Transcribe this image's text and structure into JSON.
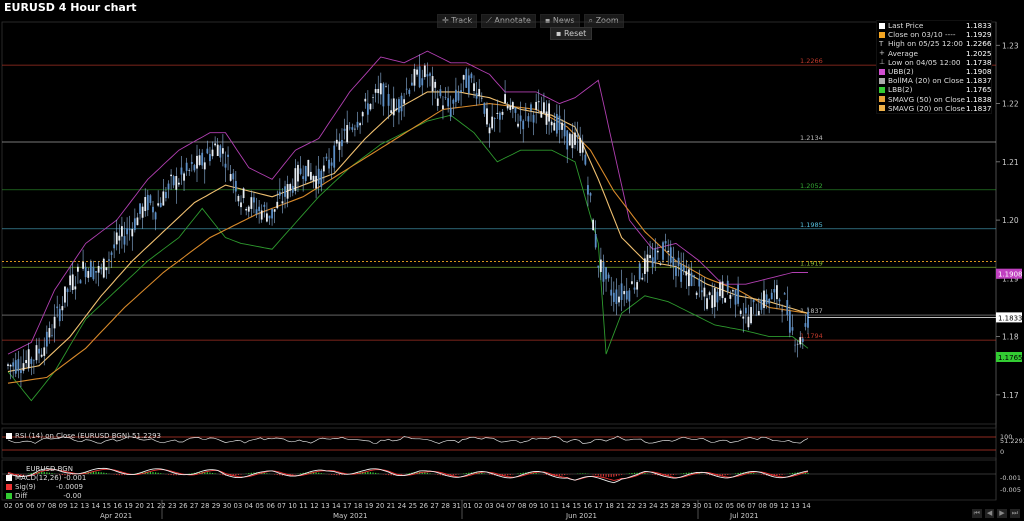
{
  "title": "EURUSD 4 Hour chart",
  "toolbar": {
    "track": "Track",
    "annotate": "Annotate",
    "news": "News",
    "zoom": "Zoom",
    "reset": "Reset"
  },
  "legend": [
    {
      "label": "Last Price",
      "value": "1.1833",
      "color": "#ffffff"
    },
    {
      "label": "Close on 03/10 ----",
      "value": "1.1929",
      "color": "#f5a623"
    },
    {
      "label": "High on 05/25 12:00",
      "value": "1.2266",
      "color": "#000000",
      "symbol": "T"
    },
    {
      "label": "Average",
      "value": "1.2025",
      "color": "#000000",
      "symbol": "+"
    },
    {
      "label": "Low on 04/05 12:00",
      "value": "1.1738",
      "color": "#000000",
      "symbol": "⊥"
    },
    {
      "label": "UBB(2)",
      "value": "1.1908",
      "color": "#d24fd2"
    },
    {
      "label": "BollMA (20) on Close",
      "value": "1.1837",
      "color": "#aaaaaa"
    },
    {
      "label": "LBB(2)",
      "value": "1.1765",
      "color": "#33cc33"
    },
    {
      "label": "SMAVG (50) on Close",
      "value": "1.1838",
      "color": "#e8a33a"
    },
    {
      "label": "SMAVG (20) on Close",
      "value": "1.1837",
      "color": "#f0b24a"
    }
  ],
  "rsi_legend": "RSI (14) on Close (EURUSD BGN) 51.2293",
  "macd_legend": {
    "title": "EURUSD BGN",
    "macd": "MACD(12,26)",
    "macd_val": "-0.001",
    "sig": "Sig(9)",
    "sig_val": "-0.0009",
    "diff": "Diff",
    "diff_val": "-0.00"
  },
  "right_labels": {
    "ubb": "1.1908",
    "last": "1.1833",
    "lbb": "1.1765",
    "rsi": "51.2293",
    "rsi_100": "100",
    "rsi_0": "0",
    "macd": "-0.001",
    "macd_low": "-0.005"
  },
  "months": [
    "Apr 2021",
    "May 2021",
    "Jun 2021",
    "Jul 2021"
  ],
  "days": [
    "02",
    "05",
    "06",
    "07",
    "08",
    "09",
    "12",
    "13",
    "14",
    "15",
    "16",
    "19",
    "20",
    "21",
    "22",
    "23",
    "26",
    "27",
    "28",
    "29",
    "30",
    "03",
    "04",
    "05",
    "06",
    "07",
    "10",
    "11",
    "12",
    "13",
    "14",
    "17",
    "18",
    "19",
    "20",
    "21",
    "24",
    "25",
    "26",
    "27",
    "28",
    "31",
    "01",
    "02",
    "03",
    "04",
    "07",
    "08",
    "09",
    "10",
    "11",
    "14",
    "15",
    "16",
    "17",
    "18",
    "21",
    "22",
    "23",
    "24",
    "25",
    "28",
    "29",
    "30",
    "01",
    "02",
    "05",
    "06",
    "07",
    "08",
    "09",
    "12",
    "13",
    "14"
  ],
  "chart_data": {
    "type": "candlestick",
    "ylim": [
      1.165,
      1.234
    ],
    "yticks": [
      1.17,
      1.18,
      1.19,
      1.2,
      1.21,
      1.22,
      1.23
    ],
    "hlines": [
      {
        "value": 1.2266,
        "label": "1.2266",
        "color": "#c0392b"
      },
      {
        "value": 1.2134,
        "label": "1.2134",
        "color": "#bbbbbb"
      },
      {
        "value": 1.2052,
        "label": "1.2052",
        "color": "#33aa33"
      },
      {
        "value": 1.1985,
        "label": "1.1985",
        "color": "#56c1e0"
      },
      {
        "value": 1.1919,
        "label": "1.1919",
        "color": "#88bb33"
      },
      {
        "value": 1.1837,
        "label": "1.1837",
        "color": "#bbbbbb"
      },
      {
        "value": 1.1794,
        "label": "1.1794",
        "color": "#c0392b"
      }
    ],
    "reference_close": 1.1929,
    "price_path": [
      [
        0,
        1.175
      ],
      [
        3,
        1.176
      ],
      [
        5,
        1.179
      ],
      [
        8,
        1.189
      ],
      [
        10,
        1.192
      ],
      [
        12,
        1.191
      ],
      [
        14,
        1.196
      ],
      [
        16,
        1.199
      ],
      [
        18,
        1.203
      ],
      [
        19,
        1.202
      ],
      [
        21,
        1.206
      ],
      [
        23,
        1.208
      ],
      [
        25,
        1.21
      ],
      [
        27,
        1.213
      ],
      [
        28,
        1.211
      ],
      [
        30,
        1.204
      ],
      [
        32,
        1.202
      ],
      [
        34,
        1.201
      ],
      [
        36,
        1.205
      ],
      [
        38,
        1.209
      ],
      [
        40,
        1.207
      ],
      [
        42,
        1.211
      ],
      [
        44,
        1.216
      ],
      [
        46,
        1.219
      ],
      [
        48,
        1.222
      ],
      [
        50,
        1.219
      ],
      [
        52,
        1.224
      ],
      [
        54,
        1.225
      ],
      [
        55,
        1.222
      ],
      [
        57,
        1.219
      ],
      [
        59,
        1.224
      ],
      [
        61,
        1.222
      ],
      [
        62,
        1.215
      ],
      [
        64,
        1.22
      ],
      [
        66,
        1.217
      ],
      [
        68,
        1.219
      ],
      [
        70,
        1.218
      ],
      [
        72,
        1.214
      ],
      [
        74,
        1.213
      ],
      [
        75,
        1.203
      ],
      [
        76,
        1.193
      ],
      [
        78,
        1.187
      ],
      [
        80,
        1.188
      ],
      [
        82,
        1.192
      ],
      [
        84,
        1.194
      ],
      [
        85,
        1.196
      ],
      [
        86,
        1.192
      ],
      [
        88,
        1.19
      ],
      [
        90,
        1.186
      ],
      [
        92,
        1.188
      ],
      [
        94,
        1.187
      ],
      [
        95,
        1.183
      ],
      [
        97,
        1.186
      ],
      [
        99,
        1.187
      ],
      [
        100,
        1.186
      ],
      [
        101,
        1.181
      ],
      [
        102,
        1.179
      ],
      [
        103,
        1.183
      ]
    ],
    "sma20": [
      [
        0,
        1.174
      ],
      [
        4,
        1.175
      ],
      [
        8,
        1.18
      ],
      [
        12,
        1.187
      ],
      [
        16,
        1.193
      ],
      [
        20,
        1.198
      ],
      [
        24,
        1.203
      ],
      [
        28,
        1.206
      ],
      [
        31,
        1.205
      ],
      [
        34,
        1.204
      ],
      [
        38,
        1.206
      ],
      [
        42,
        1.208
      ],
      [
        46,
        1.214
      ],
      [
        50,
        1.219
      ],
      [
        54,
        1.222
      ],
      [
        58,
        1.222
      ],
      [
        62,
        1.221
      ],
      [
        66,
        1.219
      ],
      [
        70,
        1.218
      ],
      [
        73,
        1.216
      ],
      [
        76,
        1.207
      ],
      [
        79,
        1.197
      ],
      [
        82,
        1.193
      ],
      [
        86,
        1.192
      ],
      [
        90,
        1.189
      ],
      [
        94,
        1.187
      ],
      [
        98,
        1.186
      ],
      [
        103,
        1.184
      ]
    ],
    "sma50": [
      [
        0,
        1.172
      ],
      [
        5,
        1.173
      ],
      [
        10,
        1.178
      ],
      [
        15,
        1.185
      ],
      [
        20,
        1.191
      ],
      [
        26,
        1.197
      ],
      [
        32,
        1.201
      ],
      [
        38,
        1.204
      ],
      [
        44,
        1.209
      ],
      [
        50,
        1.214
      ],
      [
        56,
        1.219
      ],
      [
        62,
        1.22
      ],
      [
        68,
        1.219
      ],
      [
        72,
        1.216
      ],
      [
        75,
        1.212
      ],
      [
        78,
        1.205
      ],
      [
        82,
        1.198
      ],
      [
        86,
        1.193
      ],
      [
        90,
        1.19
      ],
      [
        94,
        1.188
      ],
      [
        98,
        1.185
      ],
      [
        103,
        1.184
      ]
    ],
    "ubb": [
      [
        0,
        1.177
      ],
      [
        3,
        1.179
      ],
      [
        6,
        1.188
      ],
      [
        10,
        1.196
      ],
      [
        14,
        1.2
      ],
      [
        18,
        1.207
      ],
      [
        22,
        1.212
      ],
      [
        26,
        1.215
      ],
      [
        28,
        1.215
      ],
      [
        31,
        1.209
      ],
      [
        34,
        1.207
      ],
      [
        37,
        1.212
      ],
      [
        40,
        1.214
      ],
      [
        44,
        1.222
      ],
      [
        48,
        1.228
      ],
      [
        51,
        1.227
      ],
      [
        54,
        1.229
      ],
      [
        57,
        1.227
      ],
      [
        59,
        1.227
      ],
      [
        62,
        1.225
      ],
      [
        64,
        1.222
      ],
      [
        68,
        1.222
      ],
      [
        71,
        1.22
      ],
      [
        73,
        1.221
      ],
      [
        76,
        1.224
      ],
      [
        78,
        1.212
      ],
      [
        80,
        1.2
      ],
      [
        83,
        1.195
      ],
      [
        86,
        1.196
      ],
      [
        89,
        1.193
      ],
      [
        92,
        1.189
      ],
      [
        95,
        1.189
      ],
      [
        98,
        1.19
      ],
      [
        101,
        1.191
      ],
      [
        103,
        1.191
      ]
    ],
    "lbb": [
      [
        0,
        1.174
      ],
      [
        3,
        1.169
      ],
      [
        6,
        1.174
      ],
      [
        10,
        1.183
      ],
      [
        14,
        1.188
      ],
      [
        18,
        1.193
      ],
      [
        22,
        1.197
      ],
      [
        25,
        1.202
      ],
      [
        28,
        1.197
      ],
      [
        30,
        1.196
      ],
      [
        34,
        1.195
      ],
      [
        36,
        1.198
      ],
      [
        40,
        1.204
      ],
      [
        44,
        1.209
      ],
      [
        48,
        1.213
      ],
      [
        51,
        1.215
      ],
      [
        54,
        1.217
      ],
      [
        57,
        1.218
      ],
      [
        60,
        1.215
      ],
      [
        63,
        1.21
      ],
      [
        66,
        1.212
      ],
      [
        70,
        1.212
      ],
      [
        73,
        1.21
      ],
      [
        76,
        1.196
      ],
      [
        77,
        1.177
      ],
      [
        79,
        1.184
      ],
      [
        82,
        1.187
      ],
      [
        85,
        1.186
      ],
      [
        88,
        1.184
      ],
      [
        91,
        1.182
      ],
      [
        95,
        1.181
      ],
      [
        98,
        1.18
      ],
      [
        101,
        1.18
      ],
      [
        103,
        1.178
      ]
    ]
  }
}
